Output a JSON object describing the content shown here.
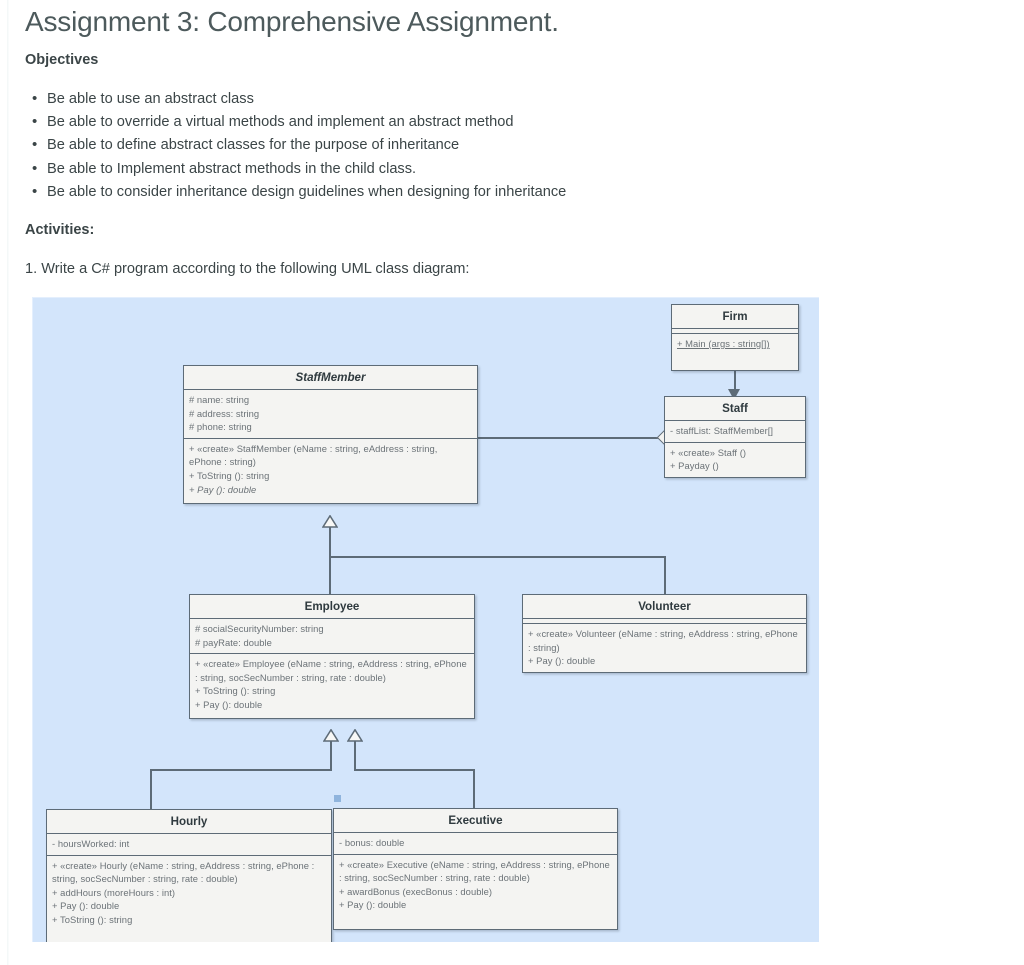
{
  "document": {
    "title": "Assignment 3: Comprehensive Assignment.",
    "objectives_heading": "Objectives",
    "objectives": [
      "Be able to use  an abstract class",
      "Be able to override a virtual methods and implement an abstract method",
      "Be able to define abstract classes for the purpose of inheritance",
      "Be able to Implement abstract methods in the child class.",
      "Be able to consider inheritance design guidelines when designing for inheritance"
    ],
    "activities_heading": "Activities:",
    "activity_1": "1. Write a C# program according to the following UML class diagram:"
  },
  "colors": {
    "page_background": "#ffffff",
    "text": "#3b4547",
    "title_text": "#4d5a5c",
    "diagram_background": "#d3e5fb",
    "class_box_fill": "#f4f4f2",
    "class_box_border": "#5d6b77",
    "member_text": "#6b7277"
  },
  "diagram": {
    "kind": "uml-class-diagram",
    "classes": {
      "firm": {
        "name": "Firm",
        "abstract": false,
        "attributes": [],
        "operations": [
          {
            "text": "+ Main (args : string[])",
            "static": true,
            "abstract": false
          }
        ]
      },
      "staff": {
        "name": "Staff",
        "abstract": false,
        "attributes": [
          {
            "text": "- staffList: StaffMember[]"
          }
        ],
        "operations": [
          {
            "text": "+ «create» Staff ()",
            "abstract": false
          },
          {
            "text": "+ Payday ()",
            "abstract": false
          }
        ]
      },
      "staffmember": {
        "name": "StaffMember",
        "abstract": true,
        "attributes": [
          {
            "text": "# name: string"
          },
          {
            "text": "# address: string"
          },
          {
            "text": "# phone: string"
          }
        ],
        "operations": [
          {
            "text": "+ «create» StaffMember (eName : string, eAddress : string, ePhone : string)",
            "abstract": false
          },
          {
            "text": "+ ToString (): string",
            "abstract": false
          },
          {
            "text": "+ Pay (): double",
            "abstract": true
          }
        ]
      },
      "employee": {
        "name": "Employee",
        "abstract": false,
        "attributes": [
          {
            "text": "# socialSecurityNumber: string"
          },
          {
            "text": "# payRate: double"
          }
        ],
        "operations": [
          {
            "text": "+ «create» Employee (eName : string, eAddress : string, ePhone : string, socSecNumber : string, rate : double)",
            "abstract": false
          },
          {
            "text": "+ ToString (): string",
            "abstract": false
          },
          {
            "text": "+ Pay (): double",
            "abstract": false
          }
        ]
      },
      "volunteer": {
        "name": "Volunteer",
        "abstract": false,
        "attributes": [],
        "operations": [
          {
            "text": "+ «create» Volunteer (eName : string, eAddress : string, ePhone : string)",
            "abstract": false
          },
          {
            "text": "+ Pay (): double",
            "abstract": false
          }
        ]
      },
      "hourly": {
        "name": "Hourly",
        "abstract": false,
        "attributes": [
          {
            "text": "- hoursWorked: int"
          }
        ],
        "operations": [
          {
            "text": "+ «create» Hourly (eName : string, eAddress : string, ePhone : string, socSecNumber : string, rate : double)",
            "abstract": false
          },
          {
            "text": "+ addHours (moreHours : int)",
            "abstract": false
          },
          {
            "text": "+ Pay (): double",
            "abstract": false
          },
          {
            "text": "+ ToString (): string",
            "abstract": false
          }
        ]
      },
      "executive": {
        "name": "Executive",
        "abstract": false,
        "attributes": [
          {
            "text": "- bonus: double"
          }
        ],
        "operations": [
          {
            "text": "+ «create» Executive (eName : string, eAddress : string, ePhone : string, socSecNumber : string, rate : double)",
            "abstract": false
          },
          {
            "text": "+ awardBonus (execBonus : double)",
            "abstract": false
          },
          {
            "text": "+ Pay (): double",
            "abstract": false
          }
        ]
      }
    },
    "relationships": [
      {
        "type": "dependency-arrow",
        "from": "Firm",
        "to": "Staff"
      },
      {
        "type": "aggregation",
        "from": "StaffMember",
        "to": "Staff"
      },
      {
        "type": "generalization",
        "from": "Employee",
        "to": "StaffMember"
      },
      {
        "type": "generalization",
        "from": "Volunteer",
        "to": "StaffMember"
      },
      {
        "type": "generalization",
        "from": "Hourly",
        "to": "Employee"
      },
      {
        "type": "generalization",
        "from": "Executive",
        "to": "Employee"
      }
    ]
  }
}
